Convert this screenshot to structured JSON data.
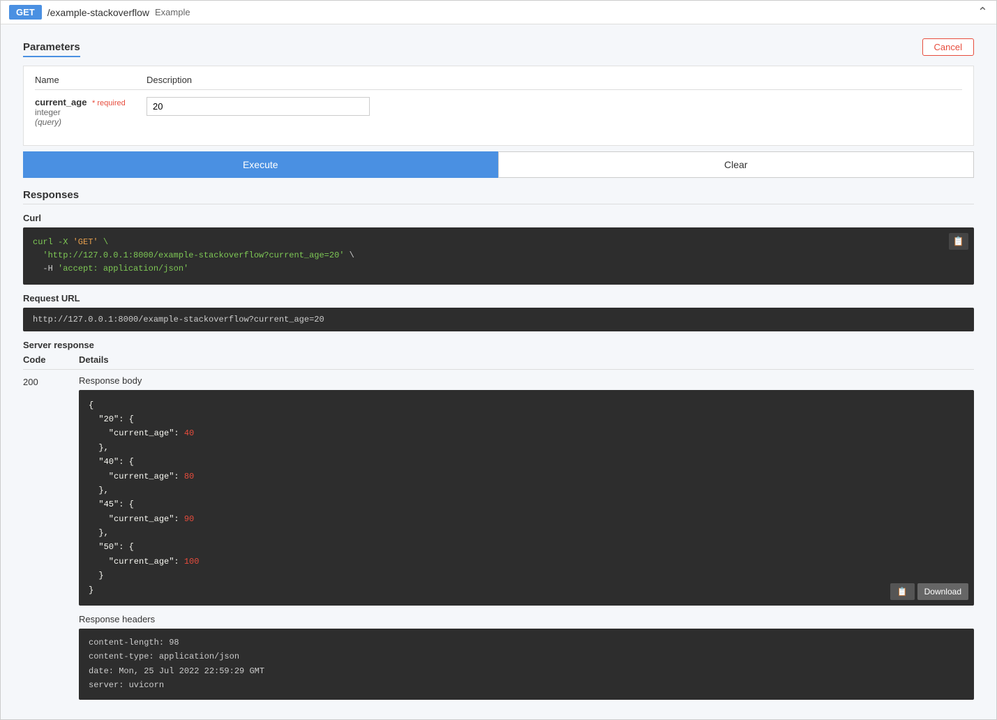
{
  "header": {
    "method": "GET",
    "path": "/example-stackoverflow",
    "description": "Example",
    "collapse_icon": "⌃"
  },
  "params_section": {
    "title": "Parameters",
    "cancel_label": "Cancel",
    "table": {
      "col_name": "Name",
      "col_description": "Description"
    },
    "params": [
      {
        "name": "current_age",
        "required": true,
        "required_label": "* required",
        "type": "integer",
        "location": "(query)",
        "value": "20"
      }
    ]
  },
  "actions": {
    "execute_label": "Execute",
    "clear_label": "Clear"
  },
  "responses_section": {
    "title": "Responses",
    "curl": {
      "title": "Curl",
      "line1": "curl -X 'GET' \\",
      "line2": "  'http://127.0.0.1:8000/example-stackoverflow?current_age=20' \\",
      "line3": "  -H 'accept: application/json'"
    },
    "request_url": {
      "title": "Request URL",
      "url": "http://127.0.0.1:8000/example-stackoverflow?current_age=20"
    },
    "server_response": {
      "title": "Server response",
      "col_code": "Code",
      "col_details": "Details",
      "code": "200",
      "response_body_label": "Response body",
      "response_body": {
        "raw": "{\n  \"20\": {\n    \"current_age\": 40\n  },\n  \"40\": {\n    \"current_age\": 80\n  },\n  \"45\": {\n    \"current_age\": 90\n  },\n  \"50\": {\n    \"current_age\": 100\n  }\n}"
      },
      "download_label": "Download",
      "response_headers_label": "Response headers",
      "response_headers": {
        "content_length": "content-length: 98",
        "content_type": "content-type: application/json",
        "date": "date: Mon, 25 Jul 2022 22:59:29 GMT",
        "server": "server: uvicorn"
      }
    }
  }
}
